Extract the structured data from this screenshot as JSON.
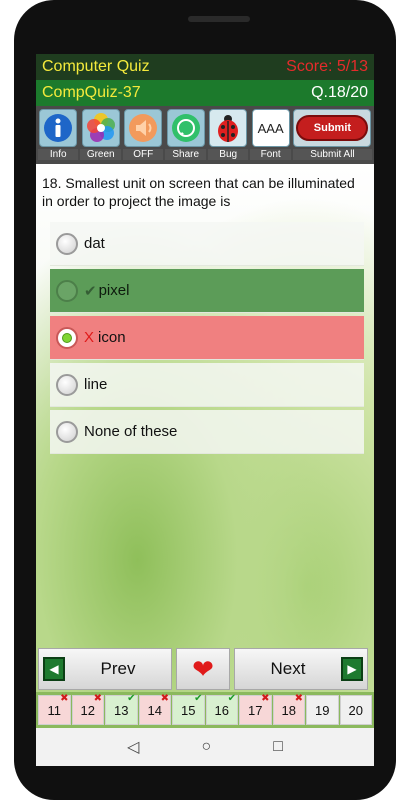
{
  "header": {
    "app_title": "Computer Quiz",
    "score": "Score: 5/13",
    "quiz_code": "CompQuiz-37",
    "question_counter": "Q.18/20"
  },
  "toolbar": {
    "items": [
      {
        "label": "Info",
        "icon": "info-icon"
      },
      {
        "label": "Green",
        "icon": "color-palette-icon"
      },
      {
        "label": "OFF",
        "icon": "speaker-icon"
      },
      {
        "label": "Share",
        "icon": "share-icon"
      },
      {
        "label": "Bug",
        "icon": "ladybug-icon"
      },
      {
        "label": "Font",
        "icon": "font-size-icon",
        "glyph": "AAA"
      }
    ],
    "submit_button": "Submit",
    "submit_all_label": "Submit All"
  },
  "question": {
    "text": "18. Smallest unit on screen that can be illuminated in order to project the image is"
  },
  "options": [
    {
      "text": "dat",
      "state": "none"
    },
    {
      "text": "pixel",
      "state": "correct",
      "mark": "✔"
    },
    {
      "text": "icon",
      "state": "wrong",
      "mark": "X"
    },
    {
      "text": "line",
      "state": "none"
    },
    {
      "text": "None of these",
      "state": "none"
    }
  ],
  "nav": {
    "prev_label": "Prev",
    "next_label": "Next",
    "heart": "❤",
    "prev_arrow": "◀",
    "next_arrow": "▶"
  },
  "question_strip": [
    {
      "num": "11",
      "status": "wrong",
      "mark": "✖"
    },
    {
      "num": "12",
      "status": "wrong",
      "mark": "✖"
    },
    {
      "num": "13",
      "status": "right",
      "mark": "✔"
    },
    {
      "num": "14",
      "status": "wrong",
      "mark": "✖"
    },
    {
      "num": "15",
      "status": "right",
      "mark": "✔"
    },
    {
      "num": "16",
      "status": "right",
      "mark": "✔"
    },
    {
      "num": "17",
      "status": "wrong",
      "mark": "✖"
    },
    {
      "num": "18",
      "status": "wrong",
      "mark": "✖"
    },
    {
      "num": "19",
      "status": "none",
      "mark": ""
    },
    {
      "num": "20",
      "status": "none",
      "mark": ""
    }
  ],
  "system_nav": {
    "back": "◁",
    "home": "○",
    "recents": "□"
  },
  "colors": {
    "header_dark": "#1f3d1f",
    "header_green": "#1c7a2c",
    "title_yellow": "#f4ea3c",
    "score_red": "#e52b2b",
    "correct_bg": "#5c9c58",
    "wrong_bg": "#f08080",
    "submit_red": "#c41e1e"
  }
}
